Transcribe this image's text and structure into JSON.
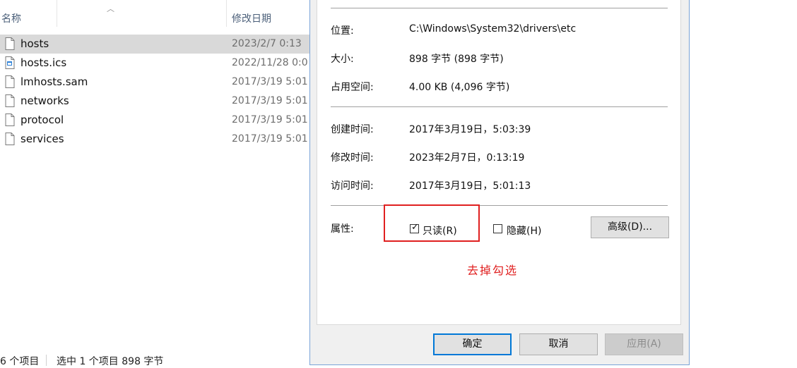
{
  "explorer": {
    "columns": {
      "name": "名称",
      "date_modified": "修改日期"
    },
    "files": [
      {
        "name": "hosts",
        "date": "2023/2/7 0:13",
        "icon": "file-icon",
        "selected": true
      },
      {
        "name": "hosts.ics",
        "date": "2022/11/28 0:0",
        "icon": "calendar-file-icon",
        "selected": false
      },
      {
        "name": "lmhosts.sam",
        "date": "2017/3/19 5:01",
        "icon": "file-icon",
        "selected": false
      },
      {
        "name": "networks",
        "date": "2017/3/19 5:01",
        "icon": "file-icon",
        "selected": false
      },
      {
        "name": "protocol",
        "date": "2017/3/19 5:01",
        "icon": "file-icon",
        "selected": false
      },
      {
        "name": "services",
        "date": "2017/3/19 5:01",
        "icon": "file-icon",
        "selected": false
      }
    ],
    "status": {
      "count": "6 个项目",
      "selection": "选中 1 个项目  898 字节"
    }
  },
  "dialog": {
    "location_label": "位置:",
    "location_value": "C:\\Windows\\System32\\drivers\\etc",
    "size_label": "大小:",
    "size_value": "898 字节 (898 字节)",
    "disk_size_label": "占用空间:",
    "disk_size_value": "4.00 KB (4,096 字节)",
    "created_label": "创建时间:",
    "created_value": "2017年3月19日，5:03:39",
    "modified_label": "修改时间:",
    "modified_value": "2023年2月7日，0:13:19",
    "accessed_label": "访问时间:",
    "accessed_value": "2017年3月19日，5:01:13",
    "attributes_label": "属性:",
    "readonly_label": "只读(R)",
    "readonly_checked": true,
    "hidden_label": "隐藏(H)",
    "hidden_checked": false,
    "advanced_button": "高级(D)...",
    "annotation": "去掉勾选",
    "annotation_color": "#e02020",
    "ok_button": "确定",
    "cancel_button": "取消",
    "apply_button": "应用(A)"
  }
}
